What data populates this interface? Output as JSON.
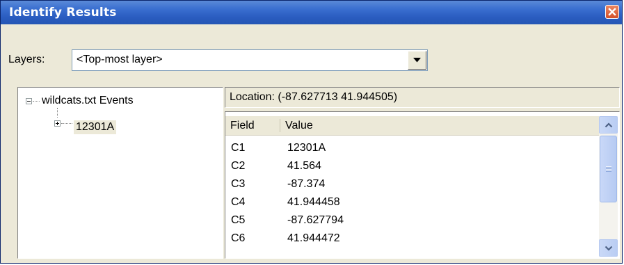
{
  "window": {
    "title": "Identify Results"
  },
  "layers": {
    "label": "Layers:",
    "selected": "<Top-most layer>"
  },
  "tree": {
    "root_label": "wildcats.txt Events",
    "child_label": "12301A"
  },
  "location": {
    "text": "Location: (-87.627713 41.944505)"
  },
  "table": {
    "headers": [
      "Field",
      "Value"
    ],
    "rows": [
      {
        "field": "C1",
        "value": "12301A"
      },
      {
        "field": "C2",
        "value": "41.564"
      },
      {
        "field": "C3",
        "value": "-87.374"
      },
      {
        "field": "C4",
        "value": "41.944458"
      },
      {
        "field": "C5",
        "value": "-87.627794"
      },
      {
        "field": "C6",
        "value": "41.944472"
      }
    ]
  },
  "icons": {
    "close": "close-icon",
    "dropdown": "chevron-down-icon",
    "scroll_up": "chevron-up-icon",
    "scroll_down": "chevron-down-icon",
    "expand": "plus-icon",
    "collapse": "minus-icon"
  },
  "colors": {
    "titlebar": "#2a5cc0",
    "close_button": "#d4512a",
    "panel_bg": "#ece9d8"
  }
}
